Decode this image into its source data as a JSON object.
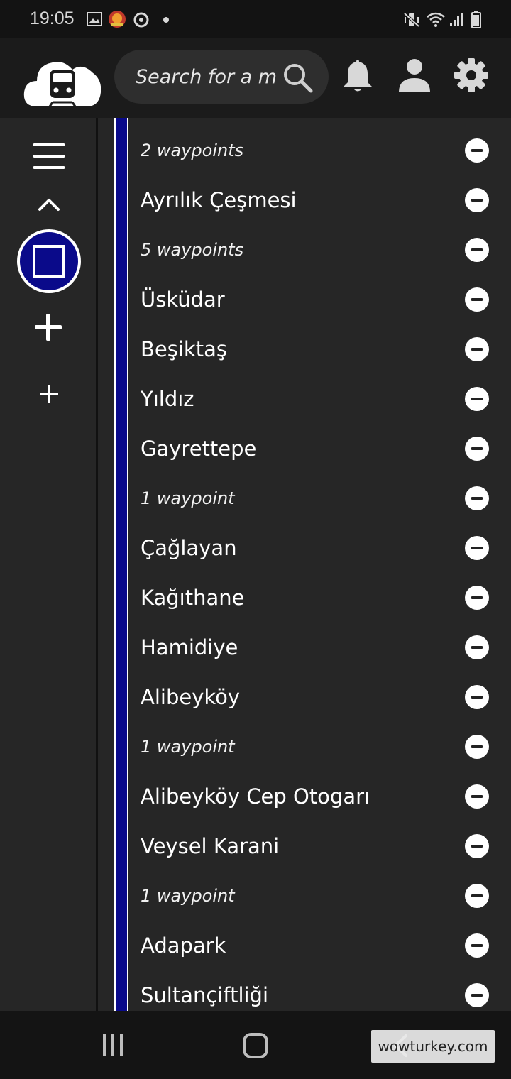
{
  "status_bar": {
    "time": "19:05",
    "left_icons": [
      "image-icon",
      "game-avatar-icon",
      "sync-icon",
      "dot-icon"
    ],
    "right_icons": [
      "mute-vibrate-icon",
      "wifi-icon",
      "signal-icon",
      "battery-icon"
    ]
  },
  "app_bar": {
    "logo": "cloud-train-logo",
    "search": {
      "placeholder": "Search for a map",
      "value": ""
    },
    "icons": [
      "bell-icon",
      "user-icon",
      "gear-icon"
    ]
  },
  "sidebar": {
    "items": [
      "menu-icon",
      "chevron-up-icon",
      "line-color-icon",
      "plus-large-icon",
      "plus-small-icon"
    ],
    "line_color": "#0a0a8a"
  },
  "route": {
    "line_color": "#0a0a8a",
    "stops": [
      {
        "label": "2 waypoints",
        "type": "waypoint"
      },
      {
        "label": "Ayrılık Çeşmesi",
        "type": "station"
      },
      {
        "label": "5 waypoints",
        "type": "waypoint"
      },
      {
        "label": "Üsküdar",
        "type": "station"
      },
      {
        "label": "Beşiktaş",
        "type": "station"
      },
      {
        "label": "Yıldız",
        "type": "station"
      },
      {
        "label": "Gayrettepe",
        "type": "station"
      },
      {
        "label": "1 waypoint",
        "type": "waypoint"
      },
      {
        "label": "Çağlayan",
        "type": "station"
      },
      {
        "label": "Kağıthane",
        "type": "station"
      },
      {
        "label": "Hamidiye",
        "type": "station"
      },
      {
        "label": "Alibeyköy",
        "type": "station"
      },
      {
        "label": "1 waypoint",
        "type": "waypoint"
      },
      {
        "label": "Alibeyköy Cep Otogarı",
        "type": "station"
      },
      {
        "label": "Veysel Karani",
        "type": "station"
      },
      {
        "label": "1 waypoint",
        "type": "waypoint"
      },
      {
        "label": "Adapark",
        "type": "station"
      },
      {
        "label": "Sultançiftliği",
        "type": "station"
      }
    ]
  },
  "nav_bar": {
    "icons": [
      "recent-apps-icon",
      "home-icon",
      "back-icon"
    ],
    "watermark": "wowturkey.com"
  }
}
